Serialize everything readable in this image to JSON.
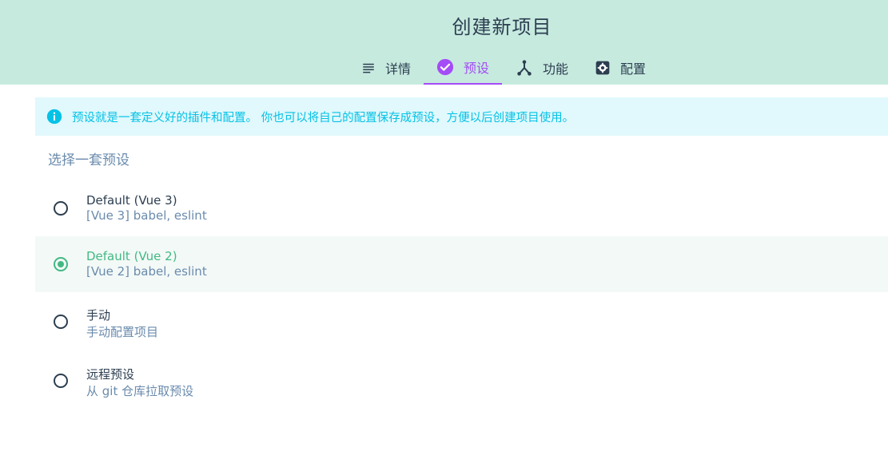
{
  "header": {
    "title": "创建新项目",
    "tabs": [
      {
        "label": "详情",
        "icon": "list-icon"
      },
      {
        "label": "预设",
        "icon": "check-circle-icon",
        "active": true
      },
      {
        "label": "功能",
        "icon": "merge-type-icon"
      },
      {
        "label": "配置",
        "icon": "settings-gear-icon"
      }
    ]
  },
  "info": {
    "text": "预设就是一套定义好的插件和配置。 你也可以将自己的配置保存成预设，方便以后创建项目使用。"
  },
  "presets": {
    "title": "选择一套预设",
    "items": [
      {
        "name": "Default (Vue 3)",
        "description": "[Vue 3] babel, eslint",
        "selected": false
      },
      {
        "name": "Default (Vue 2)",
        "description": "[Vue 2] babel, eslint",
        "selected": true
      },
      {
        "name": "手动",
        "description": "手动配置项目",
        "selected": false
      },
      {
        "name": "远程预设",
        "description": "从 git 仓库拉取预设",
        "selected": false
      }
    ]
  },
  "colors": {
    "header_bg": "#c7eadf",
    "accent_purple": "#a44cf6",
    "accent_green": "#42b983",
    "info_cyan": "#03c2e6",
    "text_dark": "#2c3e50",
    "text_muted": "#6a8bad"
  }
}
